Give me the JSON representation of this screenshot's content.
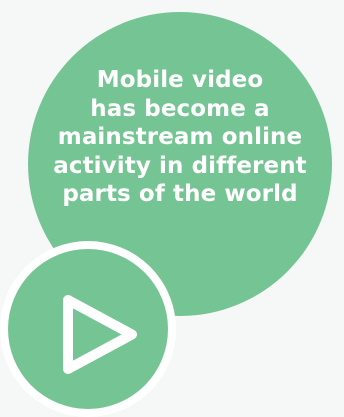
{
  "headline": {
    "lines": [
      "Mobile video",
      "has become a",
      "mainstream online",
      "activity in different",
      "parts of the world"
    ]
  },
  "icons": {
    "play": "play-icon"
  },
  "colors": {
    "background": "#f6f8f8",
    "accent_green": "#75c493",
    "text": "#ffffff",
    "ring": "#ffffff"
  }
}
